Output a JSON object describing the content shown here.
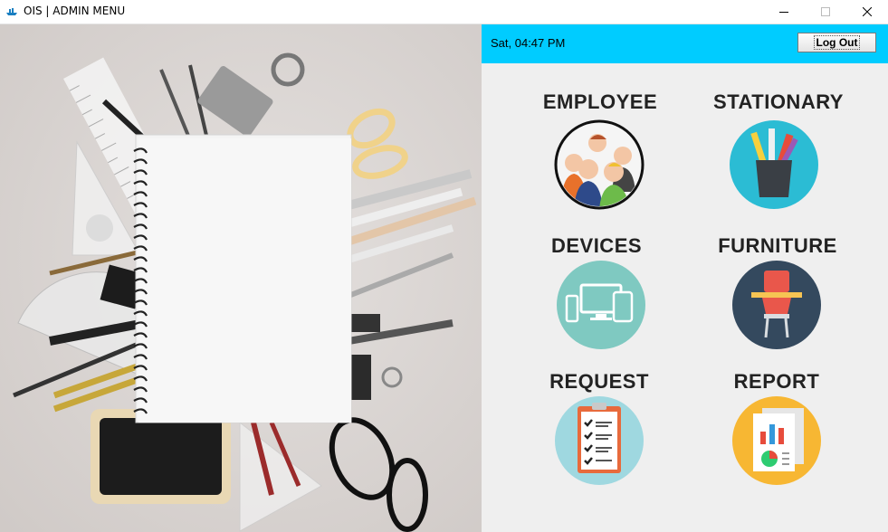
{
  "window": {
    "title": "OIS | ADMIN MENU"
  },
  "header": {
    "datetime": "Sat, 04:47 PM",
    "logout_label": "Log Out"
  },
  "menu": {
    "employee": "EMPLOYEE",
    "stationary": "STATIONARY",
    "devices": "DEVICES",
    "furniture": "FURNITURE",
    "request": "REQUEST",
    "report": "REPORT"
  },
  "colors": {
    "header_bar": "#00ccff",
    "panel_bg": "#efefef",
    "stationary_circle": "#2bbcd4",
    "devices_circle": "#7fc9c1",
    "furniture_circle": "#34495e",
    "request_circle": "#9fd8e0",
    "report_circle": "#f7b733"
  }
}
